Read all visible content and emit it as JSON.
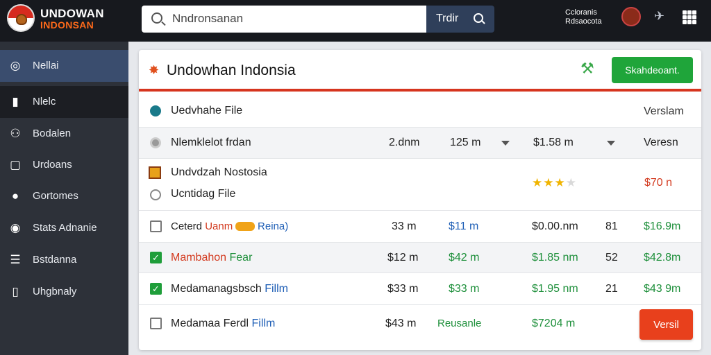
{
  "brand": {
    "line1": "UNDOWAN",
    "line2": "INDONSAN"
  },
  "search": {
    "placeholder": "Nndronsanan",
    "button": "Trdir"
  },
  "user": {
    "line1": "Ccloranis",
    "line2": "Rdsaocota"
  },
  "sidebar": {
    "items": [
      {
        "label": "Nellai",
        "icon": "compass-icon"
      },
      {
        "label": "Nlelc",
        "icon": "book-icon"
      },
      {
        "label": "Bodalen",
        "icon": "users-icon"
      },
      {
        "label": "Urdoans",
        "icon": "window-icon"
      },
      {
        "label": "Gortomes",
        "icon": "person-icon"
      },
      {
        "label": "Stats Adnanie",
        "icon": "chart-icon"
      },
      {
        "label": "Bstdanna",
        "icon": "list-icon"
      },
      {
        "label": "Uhgbnaly",
        "icon": "book-icon"
      }
    ]
  },
  "card": {
    "title": "Undowhan Indonsia",
    "primary_button": "Skahdeoant.",
    "section_label": "Uedvhahe File",
    "section_right": "Verslam",
    "filter_row": {
      "label": "Nlemklelot frdan",
      "c1": "2.dnm",
      "c2": "125 m",
      "c3": "$1.58 m",
      "c4": "Veresn"
    },
    "featured": {
      "title": "Undvdzah Nostosia",
      "subtitle": "Ucntidag File",
      "rating": 3,
      "rating_max": 4,
      "price": "$70 n"
    },
    "rows": [
      {
        "name_a": "Ceterd",
        "name_b": "Uanm",
        "badge": "",
        "name_c": "Reina)",
        "checked": false,
        "c1": "33 m",
        "c2": "$11 m",
        "c3": "$0.00.nm",
        "c4": "81",
        "c5": "$16.9m"
      },
      {
        "name_a": "Mambahon",
        "name_b": "Fear",
        "badge": "",
        "name_c": "",
        "checked": true,
        "c1": "$12 m",
        "c2": "$42 m",
        "c3": "$1.85 nm",
        "c4": "52",
        "c5": "$42.8m"
      },
      {
        "name_a": "Medamanagsbsch",
        "name_b": "Fillm",
        "badge": "",
        "name_c": "",
        "checked": true,
        "c1": "$33 m",
        "c2": "$33 m",
        "c3": "$1.95 nm",
        "c4": "21",
        "c5": "$43 9m"
      },
      {
        "name_a": "Medamaa Ferdl",
        "name_b": "Fillm",
        "badge": "",
        "name_c": "",
        "checked": false,
        "c1": "$43 m",
        "c2": "Reusanle",
        "c3": "$7204 m",
        "c4": "",
        "c5": ""
      }
    ],
    "last_row_button": "Versil"
  },
  "colors": {
    "accent_red": "#d6351f",
    "primary_green": "#1fa53a",
    "danger_orange": "#e8401c",
    "sidebar_active": "#3a4d6e"
  }
}
